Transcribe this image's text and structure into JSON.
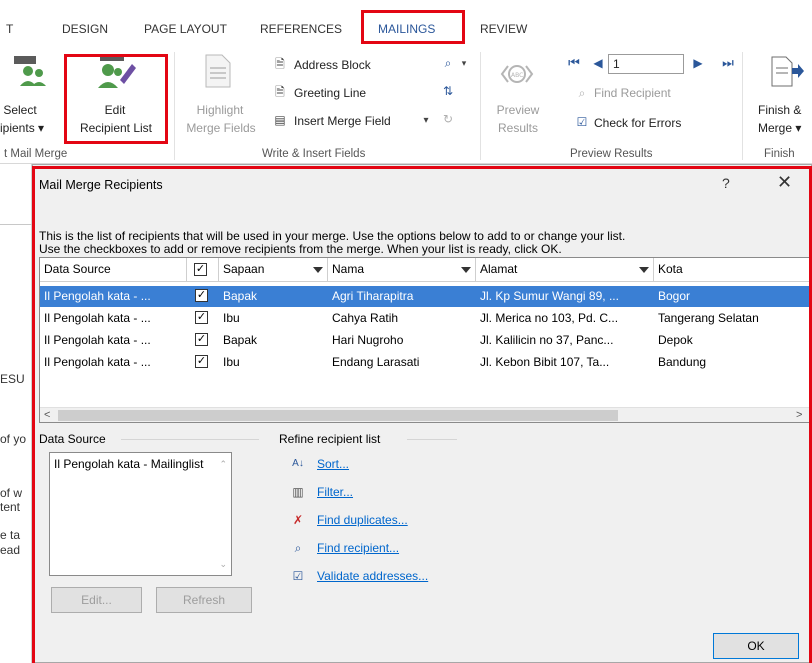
{
  "ribbon": {
    "tabs": [
      {
        "label": "T"
      },
      {
        "label": "DESIGN"
      },
      {
        "label": "PAGE LAYOUT"
      },
      {
        "label": "REFERENCES"
      },
      {
        "label": "MAILINGS"
      },
      {
        "label": "REVIEW"
      }
    ],
    "active_tab": "MAILINGS",
    "start_group": {
      "select_recipients_line1": "Select",
      "select_recipients_line2": "ipients ▾",
      "edit_list_line1": "Edit",
      "edit_list_line2": "Recipient List",
      "group_label": "t Mail Merge"
    },
    "write_group": {
      "highlight_line1": "Highlight",
      "highlight_line2": "Merge Fields",
      "address_block": "Address Block",
      "greeting_line": "Greeting Line",
      "insert_merge_field": "Insert Merge Field",
      "group_label": "Write & Insert Fields"
    },
    "preview_group": {
      "preview_line1": "Preview",
      "preview_line2": "Results",
      "record_number": "1",
      "find_recipient": "Find Recipient",
      "check_errors": "Check for Errors",
      "group_label": "Preview Results"
    },
    "finish_group": {
      "finish_line1": "Finish &",
      "finish_line2": "Merge ▾",
      "group_label": "Finish"
    }
  },
  "doc_fragments": [
    "ESU",
    "of yo",
    "of w",
    "tent",
    "e ta",
    "ead"
  ],
  "dialog": {
    "title": "Mail Merge Recipients",
    "help": "?",
    "close": "✕",
    "description_line1": "This is the list of recipients that will be used in your merge.  Use the options below to add to or change your list.",
    "description_line2": "Use the checkboxes to add or remove recipients from the merge.  When your list is ready, click OK.",
    "columns": [
      "Data Source",
      "",
      "Sapaan",
      "Nama",
      "Alamat",
      "Kota"
    ],
    "rows": [
      {
        "source": "Il Pengolah kata - ...",
        "checked": "✓",
        "sapaan": "Bapak",
        "nama": "Agri Tiharapitra",
        "alamat": "Jl. Kp Sumur Wangi 89, ...",
        "kota": "Bogor"
      },
      {
        "source": "Il Pengolah kata - ...",
        "checked": "✓",
        "sapaan": "Ibu",
        "nama": "Cahya Ratih",
        "alamat": "Jl. Merica no 103, Pd. C...",
        "kota": "Tangerang Selatan"
      },
      {
        "source": "Il Pengolah kata - ...",
        "checked": "✓",
        "sapaan": "Bapak",
        "nama": "Hari Nugroho",
        "alamat": "Jl. Kalilicin no 37, Panc...",
        "kota": "Depok"
      },
      {
        "source": "Il Pengolah kata - ...",
        "checked": "✓",
        "sapaan": "Ibu",
        "nama": "Endang Larasati",
        "alamat": "Jl. Kebon Bibit 107,  Ta...",
        "kota": "Bandung"
      }
    ],
    "selected_row": 0,
    "header_check": "✓",
    "data_source_label": "Data Source",
    "data_source_item": "Il Pengolah kata - Mailinglist",
    "edit_button": "Edit...",
    "refresh_button": "Refresh",
    "refine_label": "Refine recipient list",
    "refine_links": [
      "Sort...",
      "Filter...",
      "Find duplicates...",
      "Find recipient...",
      "Validate addresses..."
    ],
    "ok_button": "OK"
  },
  "colors": {
    "highlight_red": "#e30613",
    "selected_row": "#3a7fd4",
    "link": "#0066cc",
    "active_tab": "#2b579a"
  }
}
